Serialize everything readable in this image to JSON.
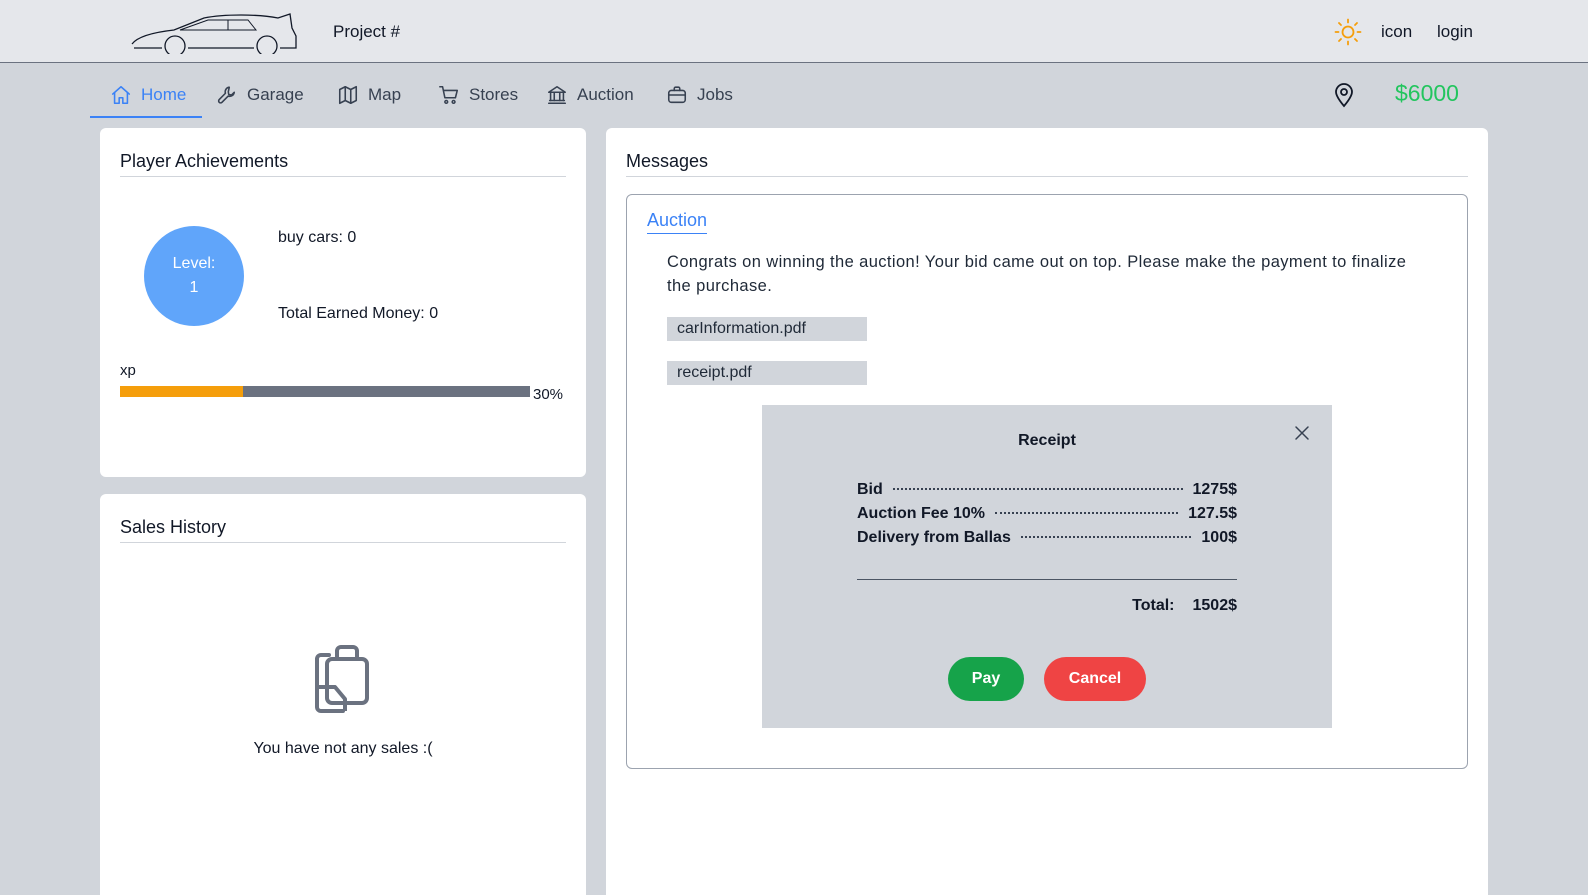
{
  "header": {
    "project_title": "Project #",
    "icon_text": "icon",
    "login": "login",
    "logo_icon": "car-silhouette-icon",
    "theme_icon": "sun-icon"
  },
  "nav": {
    "items": [
      {
        "label": "Home",
        "icon": "home-icon",
        "active": true
      },
      {
        "label": "Garage",
        "icon": "wrench-icon"
      },
      {
        "label": "Map",
        "icon": "map-icon"
      },
      {
        "label": "Stores",
        "icon": "cart-icon"
      },
      {
        "label": "Auction",
        "icon": "bank-icon"
      },
      {
        "label": "Jobs",
        "icon": "briefcase-icon"
      }
    ],
    "location_icon": "location-pin-icon",
    "money": "$6000"
  },
  "achievements": {
    "title": "Player Achievements",
    "level_label": "Level:",
    "level_value": "1",
    "buy_cars": "buy cars: 0",
    "total_earned": "Total Earned Money: 0",
    "xp_label": "xp",
    "xp_percent_text": "30%",
    "xp_progress": 0.3
  },
  "sales": {
    "title": "Sales History",
    "empty_icon": "clipboard-icon",
    "empty_text": "You have not any sales :("
  },
  "messages": {
    "title": "Messages",
    "tab": "Auction",
    "text": "Congrats on winning the auction! Your bid came out on top. Please make the payment to finalize the purchase.",
    "files": [
      "carInformation.pdf",
      "receipt.pdf"
    ]
  },
  "receipt": {
    "title": "Receipt",
    "lines": [
      {
        "label": "Bid",
        "value": "1275$"
      },
      {
        "label": "Auction Fee 10%",
        "value": "127.5$"
      },
      {
        "label": "Delivery from Ballas",
        "value": "100$"
      }
    ],
    "total_label": "Total:",
    "total_value": "1502$",
    "pay_label": "Pay",
    "cancel_label": "Cancel"
  },
  "colors": {
    "accent": "#3b82f6",
    "money": "#22c55e",
    "xp_fill": "#f59e0b",
    "pay": "#16a34a",
    "cancel": "#ef4444"
  }
}
